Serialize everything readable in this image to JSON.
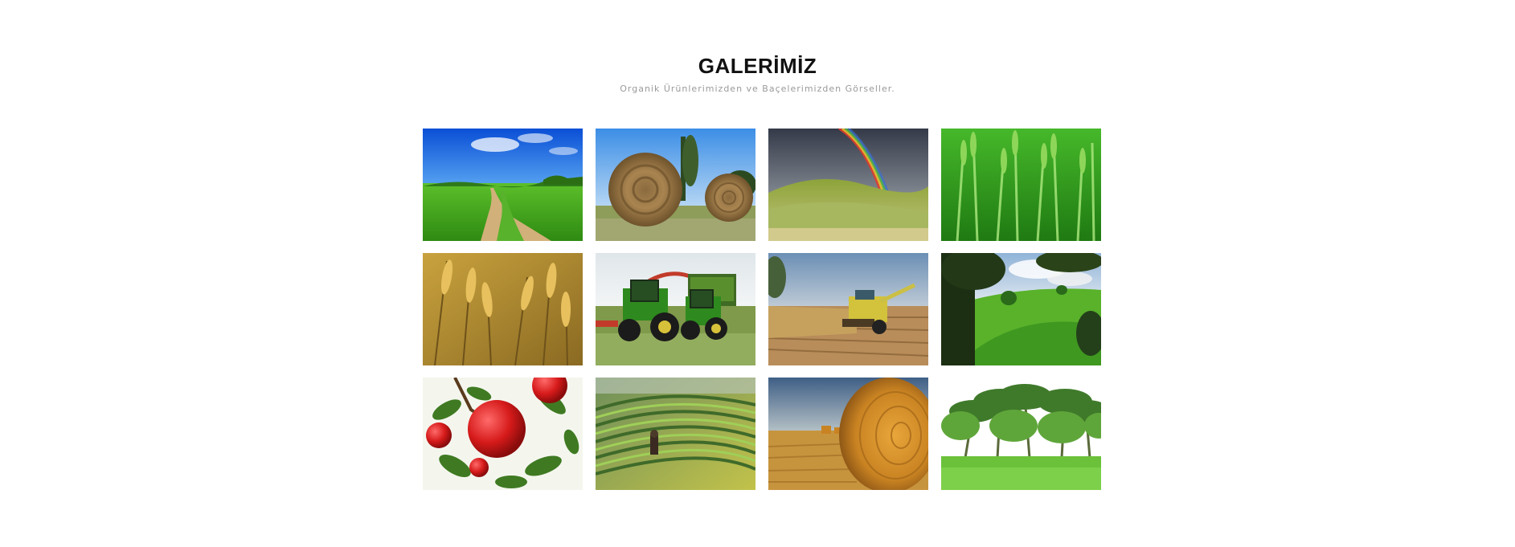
{
  "gallery": {
    "title": "GALERİMİZ",
    "subtitle": "Organik Ürünlerimizden ve Baçelerimizden Görseller."
  }
}
